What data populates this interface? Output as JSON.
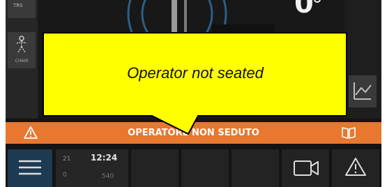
{
  "left_panel": {
    "top_button_label": "TRS",
    "seat_button_label": "CHAIR"
  },
  "center": {
    "angle_value": "0"
  },
  "alarm": {
    "message": "OPERATORE NON SEDUTO"
  },
  "status": {
    "day": "21",
    "time": "12:24",
    "sub_label": "0",
    "sub_value": "540"
  },
  "callout": {
    "text": "Operator not seated",
    "fill_color": "#ffff00"
  },
  "colors": {
    "alarm_bar": "#e8772f",
    "menu_button": "#1c3a52"
  },
  "icons": {
    "menu": "menu-icon",
    "camera": "camera-icon",
    "warning": "warning-icon",
    "manual": "book-icon"
  }
}
